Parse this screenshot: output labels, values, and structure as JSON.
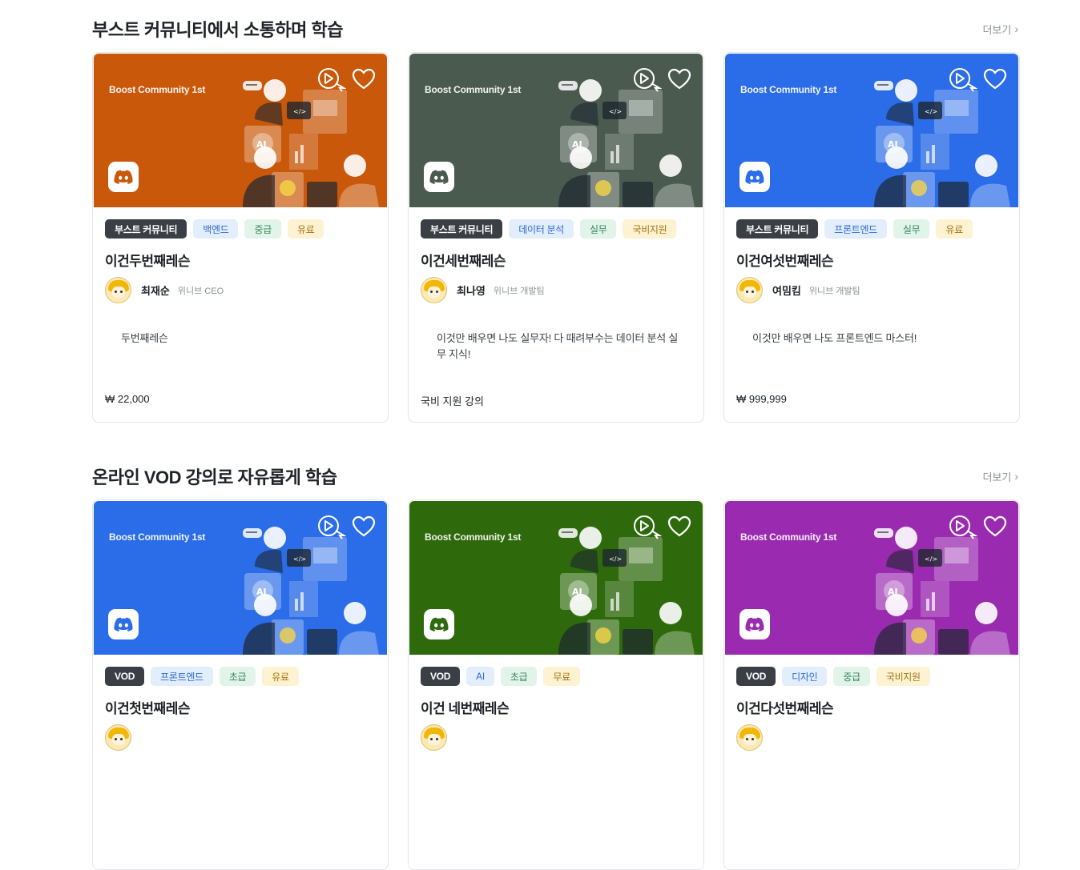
{
  "sections": [
    {
      "title": "부스트 커뮤니티에서 소통하며 학습",
      "more_label": "더보기",
      "cards": [
        {
          "bg": "#c9580a",
          "brand": "Boost Community 1st",
          "tags": [
            {
              "label": "부스트 커뮤니티",
              "style": "dark"
            },
            {
              "label": "백엔드",
              "style": "blue"
            },
            {
              "label": "중급",
              "style": "green"
            },
            {
              "label": "유료",
              "style": "yellow"
            }
          ],
          "title": "이건두번째레슨",
          "author": "최재순",
          "role": "위니브 CEO",
          "desc": "두번째레슨",
          "price": "₩ 22,000"
        },
        {
          "bg": "#4a5a4e",
          "brand": "Boost Community 1st",
          "tags": [
            {
              "label": "부스트 커뮤니티",
              "style": "dark"
            },
            {
              "label": "데이터 분석",
              "style": "blue"
            },
            {
              "label": "실무",
              "style": "green"
            },
            {
              "label": "국비지원",
              "style": "yellow"
            }
          ],
          "title": "이건세번째레슨",
          "author": "최나영",
          "role": "위니브 개발팀",
          "desc": "이것만 배우면 나도 실무자! 다 때려부수는 데이터 분석 실무 지식!",
          "price": "국비 지원 강의"
        },
        {
          "bg": "#2b6ce8",
          "brand": "Boost Community 1st",
          "tags": [
            {
              "label": "부스트 커뮤니티",
              "style": "dark"
            },
            {
              "label": "프론트엔드",
              "style": "blue"
            },
            {
              "label": "실무",
              "style": "green"
            },
            {
              "label": "유료",
              "style": "yellow"
            }
          ],
          "title": "이건여섯번째레슨",
          "author": "여밈킴",
          "role": "위니브 개발팀",
          "desc": "이것만 배우면 나도 프론트엔드 마스터!",
          "price": "₩ 999,999"
        }
      ]
    },
    {
      "title": "온라인 VOD 강의로 자유롭게 학습",
      "more_label": "더보기",
      "cards": [
        {
          "bg": "#2b6ce8",
          "brand": "Boost Community 1st",
          "tags": [
            {
              "label": "VOD",
              "style": "dark"
            },
            {
              "label": "프론트엔드",
              "style": "blue"
            },
            {
              "label": "초급",
              "style": "green"
            },
            {
              "label": "유료",
              "style": "yellow"
            }
          ],
          "title": "이건첫번째레슨",
          "author": "",
          "role": "",
          "desc": "",
          "price": ""
        },
        {
          "bg": "#2e6a0c",
          "brand": "Boost Community 1st",
          "tags": [
            {
              "label": "VOD",
              "style": "dark"
            },
            {
              "label": "AI",
              "style": "blue"
            },
            {
              "label": "초급",
              "style": "green"
            },
            {
              "label": "무료",
              "style": "yellow"
            }
          ],
          "title": "이건 네번째레슨",
          "author": "",
          "role": "",
          "desc": "",
          "price": ""
        },
        {
          "bg": "#9a2bb0",
          "brand": "Boost Community 1st",
          "tags": [
            {
              "label": "VOD",
              "style": "dark"
            },
            {
              "label": "디자인",
              "style": "blue"
            },
            {
              "label": "중급",
              "style": "green"
            },
            {
              "label": "국비지원",
              "style": "yellow"
            }
          ],
          "title": "이건다섯번째레슨",
          "author": "",
          "role": "",
          "desc": "",
          "price": ""
        }
      ]
    }
  ]
}
